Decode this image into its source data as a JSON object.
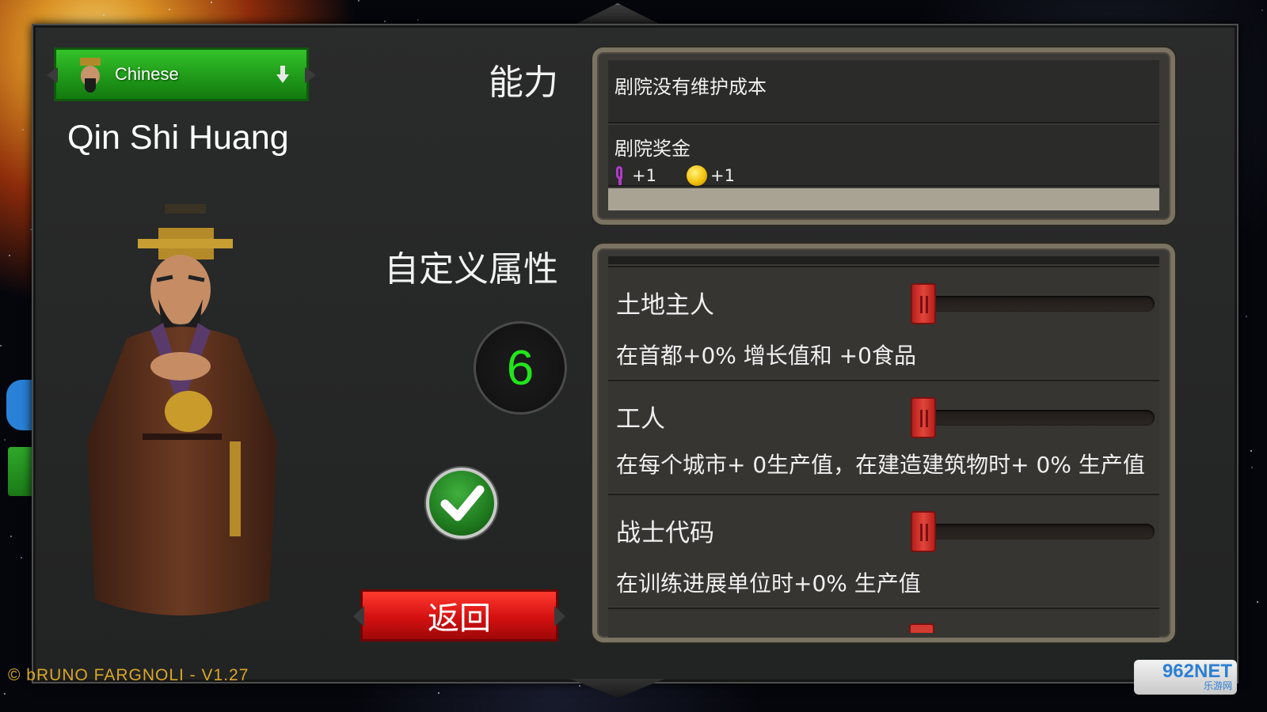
{
  "civilization": {
    "name": "Chinese",
    "leader": "Qin Shi Huang"
  },
  "labels": {
    "abilities": "能力",
    "custom_attributes": "自定义属性",
    "back_button": "返回"
  },
  "points_remaining": "6",
  "abilities": [
    {
      "title": "剧院没有维护成本"
    },
    {
      "title": "剧院奖金",
      "bonuses": [
        {
          "icon": "culture-icon",
          "value": "+1"
        },
        {
          "icon": "gold-icon",
          "value": "+1"
        }
      ]
    }
  ],
  "attributes": [
    {
      "title": "土地主人",
      "description": "在首都+0% 增长值和 +0食品",
      "level": 0
    },
    {
      "title": "工人",
      "description": "在每个城市+ 0生产值，在建造建筑物时+ 0% 生产值",
      "level": 0
    },
    {
      "title": "战士代码",
      "description": "在训练进展单位时+0% 生产值",
      "level": 0
    }
  ],
  "footer": {
    "copyright": "© bRUNO FARGNOLI - V1.27",
    "watermark_top": "962NET",
    "watermark_bottom": "乐游网"
  },
  "colors": {
    "points": "#22e51c",
    "confirm": "#1f7a1e",
    "back": "#d41010",
    "civ_dropdown": "#1f9a19",
    "slider_handle": "#e1453b"
  }
}
